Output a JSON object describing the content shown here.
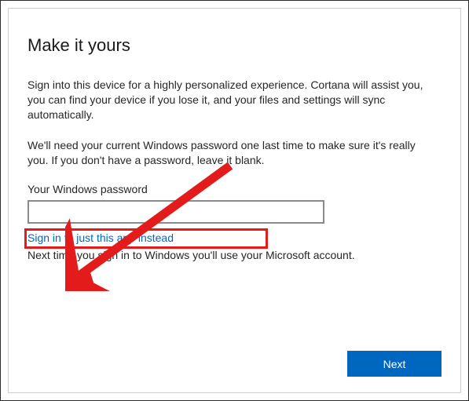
{
  "title": "Make it yours",
  "paragraph1": "Sign into this device for a highly personalized experience. Cortana will assist you, you can find your device if you lose it, and your files and settings will sync automatically.",
  "paragraph2": "We'll need your current Windows password one last time to make sure it's really you. If you don't have a password, leave it blank.",
  "passwordLabel": "Your Windows password",
  "passwordValue": "",
  "signInLink": "Sign in to just this app instead",
  "nextTimeText": "Next time you sign in to Windows you'll use your Microsoft account.",
  "nextButton": "Next",
  "colors": {
    "accent": "#0067c0",
    "highlight": "#e31b1b"
  }
}
